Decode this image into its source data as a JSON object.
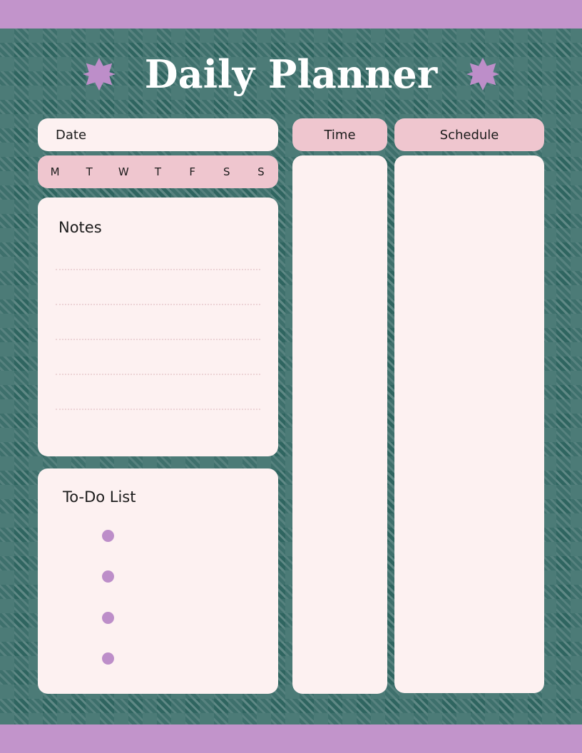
{
  "header": {
    "title": "Daily Planner",
    "left_star_icon": "eight-point-star-icon",
    "right_star_icon": "eight-point-star-icon"
  },
  "date_field": {
    "label": "Date",
    "value": ""
  },
  "weekdays": [
    {
      "label": "M",
      "name": "monday"
    },
    {
      "label": "T",
      "name": "tuesday"
    },
    {
      "label": "W",
      "name": "wednesday"
    },
    {
      "label": "T",
      "name": "thursday"
    },
    {
      "label": "F",
      "name": "friday"
    },
    {
      "label": "S",
      "name": "saturday"
    },
    {
      "label": "S",
      "name": "sunday"
    }
  ],
  "notes": {
    "title": "Notes",
    "line_count": 5,
    "lines": [
      "",
      "",
      "",
      "",
      ""
    ]
  },
  "todo": {
    "title": "To-Do List",
    "items": [
      {
        "text": "",
        "bullet": "circle-bullet-icon"
      },
      {
        "text": "",
        "bullet": "circle-bullet-icon"
      },
      {
        "text": "",
        "bullet": "circle-bullet-icon"
      },
      {
        "text": "",
        "bullet": "circle-bullet-icon"
      }
    ]
  },
  "columns": {
    "time": {
      "header": "Time",
      "content": ""
    },
    "schedule": {
      "header": "Schedule",
      "content": ""
    }
  },
  "colors": {
    "lilac_bar": "#c294cb",
    "plaid_dark_teal": "#2f6560",
    "plaid_light_teal": "#41736e",
    "card_cream": "#fdf1f1",
    "card_pink": "#efc6cf",
    "accent_purple": "#bd8ec9",
    "title_white": "#ffffff",
    "text_dark": "#1b1b1b",
    "note_line": "#ecd3d6"
  }
}
